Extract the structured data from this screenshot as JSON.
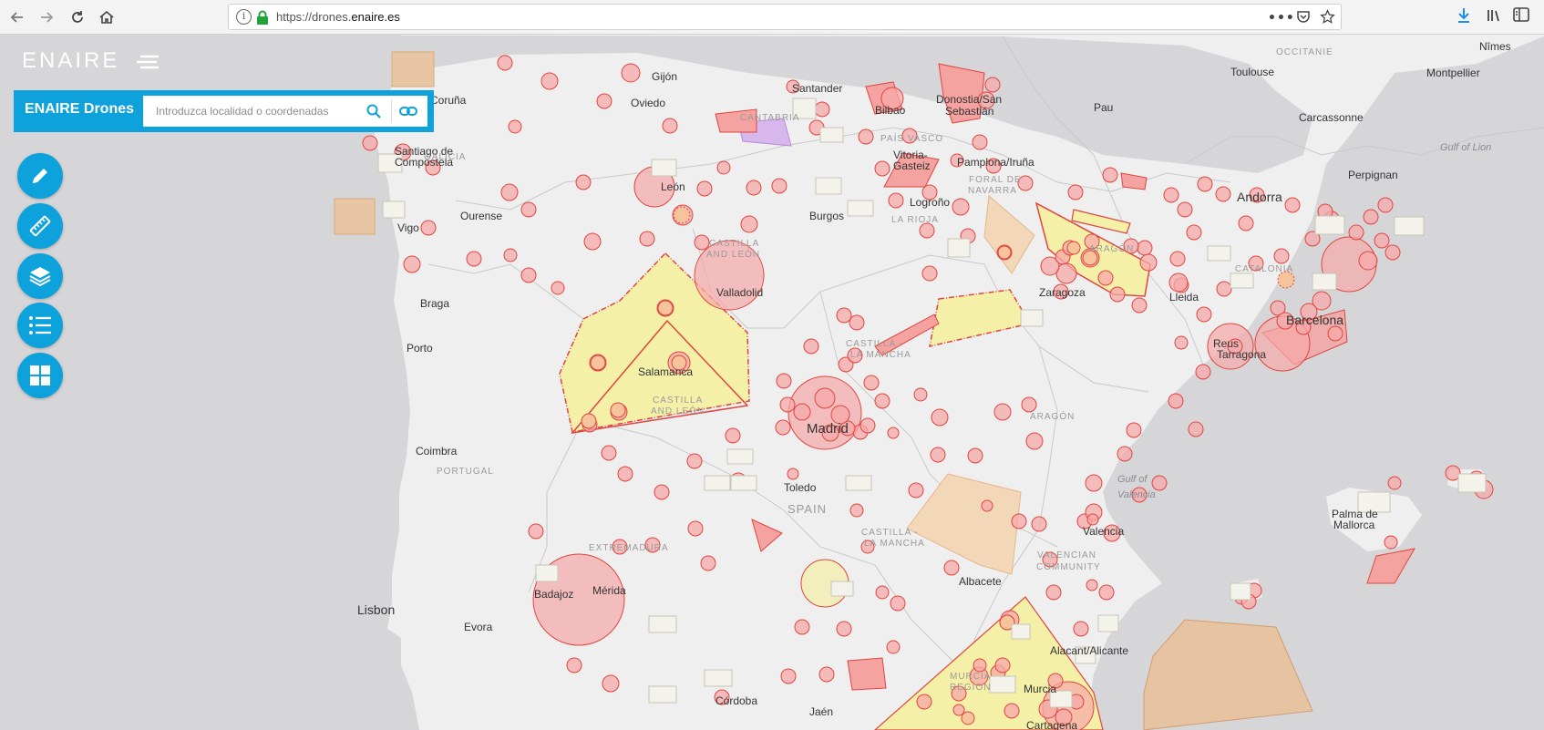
{
  "browser": {
    "url_prefix": "https://drones.",
    "url_domain": "enaire.es",
    "page_actions": "•••"
  },
  "brand": {
    "logo_text": "ENAIRE",
    "accent_color": "#0da2dc"
  },
  "search": {
    "title": "ENAIRE Drones",
    "placeholder": "Introduzca localidad o coordenadas"
  },
  "tools": [
    {
      "name": "draw",
      "icon": "pencil-icon"
    },
    {
      "name": "measure",
      "icon": "ruler-icon"
    },
    {
      "name": "layers",
      "icon": "layers-icon"
    },
    {
      "name": "legend",
      "icon": "list-icon"
    },
    {
      "name": "apps",
      "icon": "grid-icon"
    }
  ],
  "map": {
    "cities": [
      "Gijón",
      "Oviedo",
      "Santander",
      "Bilbao",
      "Donostia/San",
      "Sebastián",
      "Pau",
      "Toulouse",
      "Montpellier",
      "Nîmes",
      "Carcassonne",
      "Perpignan",
      "Andorra",
      "Coruña",
      "Santiago de",
      "Compostela",
      "León",
      "Vitoria-",
      "Gasteiz",
      "Pamplona/Iruña",
      "Logroño",
      "Burgos",
      "Ourense",
      "Vigo",
      "Valladolid",
      "Braga",
      "Porto",
      "Zaragoza",
      "Lleida",
      "Barcelona",
      "Reus",
      "Tarragona",
      "Salamanca",
      "Madrid",
      "Coimbra",
      "Toledo",
      "Valencia",
      "Palma de",
      "Mallorca",
      "Badajoz",
      "Mérida",
      "Albacete",
      "Lisbon",
      "Evora",
      "Alacant/Alicante",
      "Córdoba",
      "Jaén",
      "Murcia",
      "Cartagena"
    ],
    "regions": [
      "OCCITANIE",
      "CANTABRIA",
      "PAÍS VASCO",
      "GALICIA",
      "FORAL DE",
      "NAVARRA",
      "LA RIOJA",
      "CASTILLA",
      "AND LEÓN",
      "ARAGÓN",
      "CATALONIA",
      "CASTILLA -",
      "LA MANCHA",
      "CASTILLA",
      "AND LEÓN",
      "ARAGÓN",
      "PORTUGAL",
      "SPAIN",
      "EXTREMADURA",
      "CASTILLA -",
      "LA MANCHA",
      "VALENCIAN",
      "COMMUNITY",
      "MURCIA",
      "REGION"
    ],
    "seas": [
      "Gulf of Lion",
      "Gulf of",
      "Valencia"
    ],
    "colors": {
      "restricted_fill": "#f7a8a8",
      "restricted_stroke": "#e0453f",
      "yellow_zone": "#f5f0a8",
      "orange_zone": "#f2d2a6",
      "purple_zone": "#d8b8ec",
      "land": "#efefef",
      "sea": "#d6d6d9"
    }
  }
}
